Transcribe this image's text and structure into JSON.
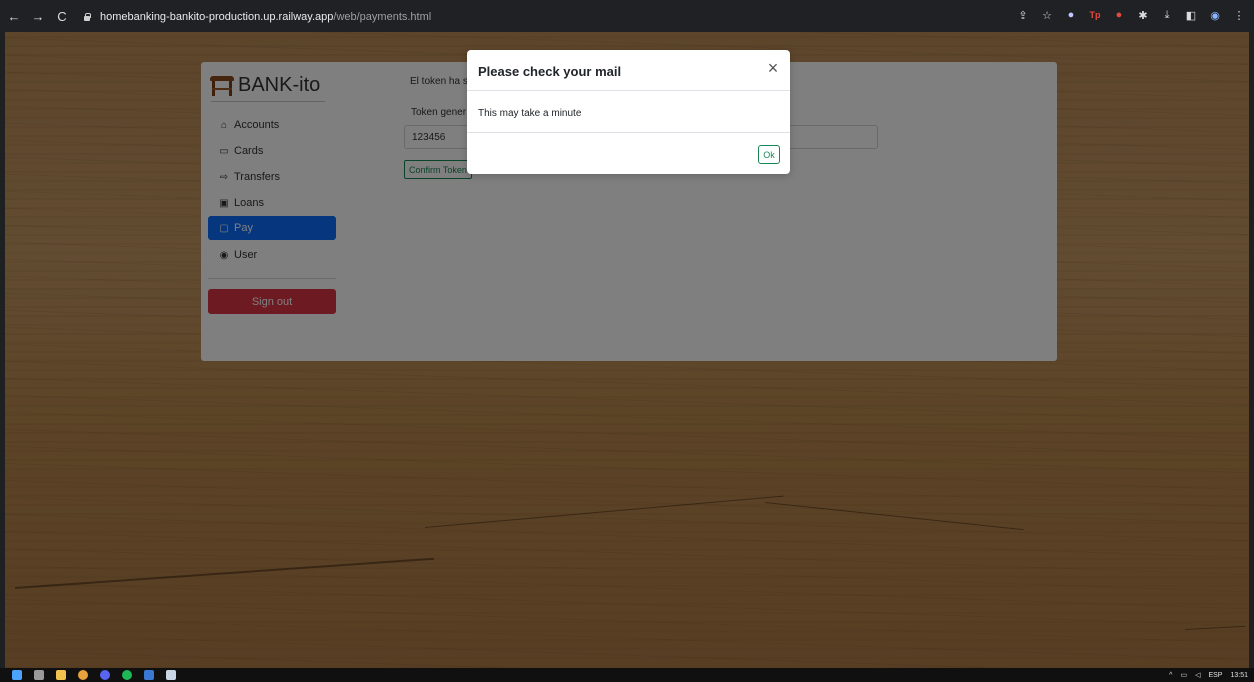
{
  "browser": {
    "url_host": "homebanking-bankito-production.up.railway.app",
    "url_path": "/web/payments.html",
    "nav": {
      "back": "←",
      "forward": "→",
      "reload": "C"
    },
    "extensions": [
      "share-icon",
      "star-icon",
      "shield-icon",
      "tp-icon",
      "record-icon",
      "puzzle-icon",
      "download-icon",
      "sidebar-icon",
      "profile-icon",
      "menu-icon"
    ]
  },
  "app": {
    "brand": "BANK-ito",
    "sidebar": {
      "items": [
        {
          "label": "Accounts",
          "icon": "bank-icon"
        },
        {
          "label": "Cards",
          "icon": "card-icon"
        },
        {
          "label": "Transfers",
          "icon": "transfer-icon"
        },
        {
          "label": "Loans",
          "icon": "cash-icon"
        },
        {
          "label": "Pay",
          "icon": "wallet-icon",
          "active": true
        },
        {
          "label": "User",
          "icon": "user-icon"
        }
      ],
      "signout_label": "Sign out"
    },
    "main": {
      "message_partial": "El token ha s",
      "token_label_partial": "Token gener",
      "token_value": "123456",
      "confirm_label_partial": "Confirm Token"
    }
  },
  "modal": {
    "title": "Please check your mail",
    "body": "This may take a minute",
    "ok_label": "Ok",
    "close_symbol": "×"
  },
  "taskbar": {
    "tray": {
      "lang": "ESP",
      "time": "13:51"
    }
  },
  "colors": {
    "primary": "#0d6efd",
    "danger": "#dc3545",
    "success": "#198754"
  }
}
